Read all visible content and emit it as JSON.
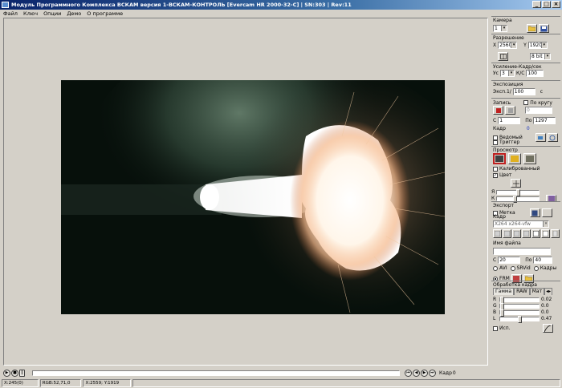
{
  "window": {
    "title": "Модуль Программного Комплекса ВСКАМ версия 1-ВСКАМ-КОНТРОЛЬ [Evercam HR 2000-32-C] | SN:303 | Rev:11"
  },
  "menu": [
    "Файл",
    "Ключ",
    "Опции",
    "Демо",
    "О программе"
  ],
  "status": {
    "coords": "X:245(0)",
    "rgb": "RGB:52,71,0",
    "size": "X:2559; Y:1919",
    "frame_label": "Кадр",
    "frame_value": "0"
  },
  "panel": {
    "camera": {
      "title": "Камера",
      "value": "1"
    },
    "resolution": {
      "title": "Разрешение",
      "x_label": "X",
      "x_value": "2560",
      "y_label": "Y",
      "y_value": "1920",
      "bits": "8 bit"
    },
    "gain": {
      "title": "Усиление-Кадр/сек",
      "gain_label": "Ус",
      "gain_value": "3",
      "fps_label": "К/С",
      "fps_value": "100"
    },
    "exposure": {
      "title": "Экспозиция",
      "label": "Эксп.1/",
      "value": "100",
      "unit": "с"
    },
    "record": {
      "title": "Запись",
      "loop_label": "По кругу",
      "from_label": "С",
      "from_value": "1",
      "to_label": "По",
      "to_value": "1297",
      "field_right": "0",
      "frame_label": "Кадр",
      "frame_value": "0",
      "slave_label": "Ведомый",
      "trigger_label": "Триггер"
    },
    "preview": {
      "title": "Просмотр",
      "calibrated_label": "Калиброванный",
      "color_label": "Цвет"
    },
    "export": {
      "title": "Экспорт",
      "mark_label": "Метка",
      "frame_label": "Кадр",
      "codec": "X264 x264-vfw",
      "filename_title": "Имя файла",
      "from_label": "С",
      "from_value": "20",
      "to_label": "По",
      "to_value": "40",
      "formats": [
        "AVI",
        "SRVid",
        "Кадры"
      ],
      "frm_label": "FRM"
    },
    "processing": {
      "title": "Обработка кадра",
      "tabs": [
        "Гамма",
        "RAW",
        "Мат"
      ],
      "sliders": [
        {
          "label": "R",
          "value": "0.02"
        },
        {
          "label": "G",
          "value": "0.0"
        },
        {
          "label": "B",
          "value": "0.0"
        },
        {
          "label": "L",
          "value": "0.47"
        }
      ],
      "use_label": "Исп."
    }
  }
}
